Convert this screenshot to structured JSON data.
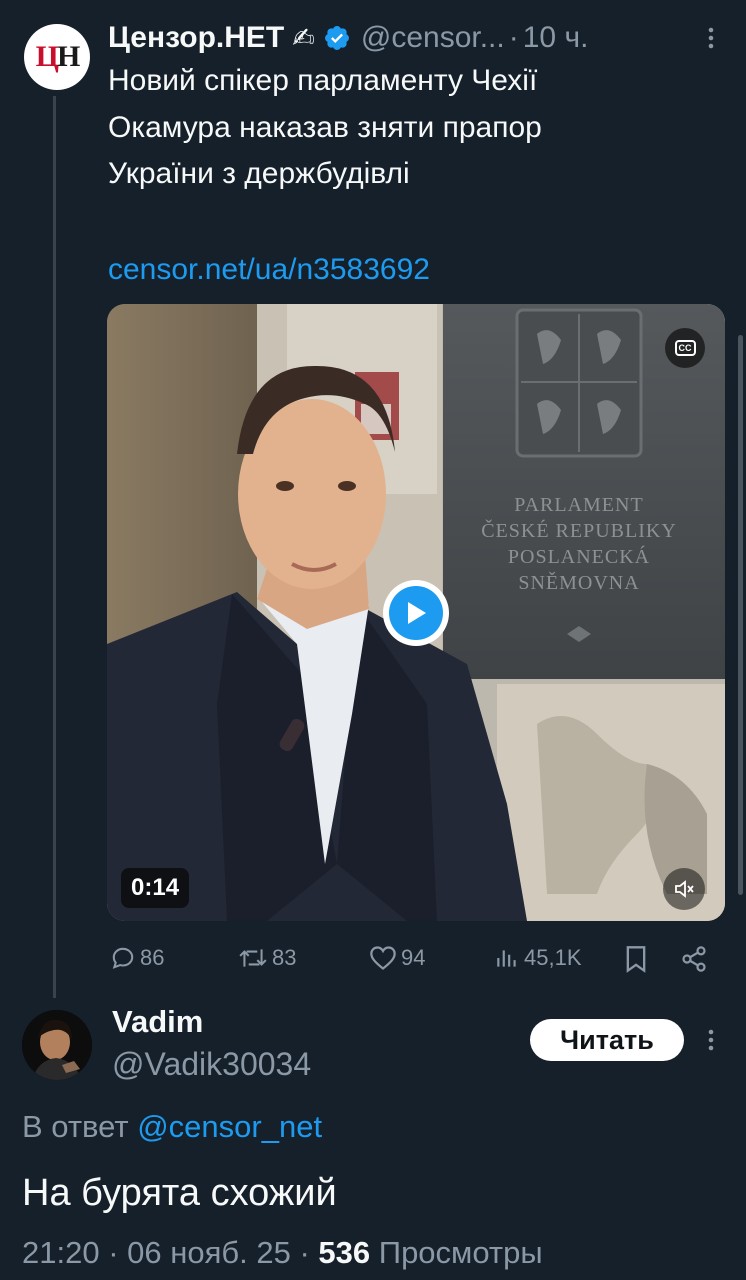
{
  "tweet": {
    "author_name": "Цензор.НЕТ",
    "author_emoji": "✍",
    "author_handle": "@censor...",
    "time": "10 ч.",
    "avatar_text_1": "Ц",
    "avatar_text_2": "Н",
    "text": "Новий спікер парламенту Чехії\nОкамура наказав зняти прапор\nУкраїни з держбудівлі",
    "link": "censor.net/ua/n3583692",
    "media": {
      "duration": "0:14",
      "captions_label": "CC",
      "sign_text": [
        "PARLAMENT",
        "ČESKÉ REPUBLIKY",
        "POSLANECKÁ",
        "SNĚMOVNA"
      ]
    },
    "actions": {
      "replies": "86",
      "retweets": "83",
      "likes": "94",
      "views": "45,1K"
    }
  },
  "reply": {
    "name": "Vadim",
    "handle": "@Vadik30034",
    "follow_label": "Читать",
    "reply_prefix": "В ответ",
    "reply_mention": "@censor_net",
    "text": "На бурята схожий",
    "time": "21:20",
    "date": "06 нояб. 25",
    "views_count": "536",
    "views_label": "Просмотры"
  },
  "colors": {
    "background": "#15202b",
    "accent": "#1d9bf0",
    "secondary_text": "#8b98a5"
  }
}
